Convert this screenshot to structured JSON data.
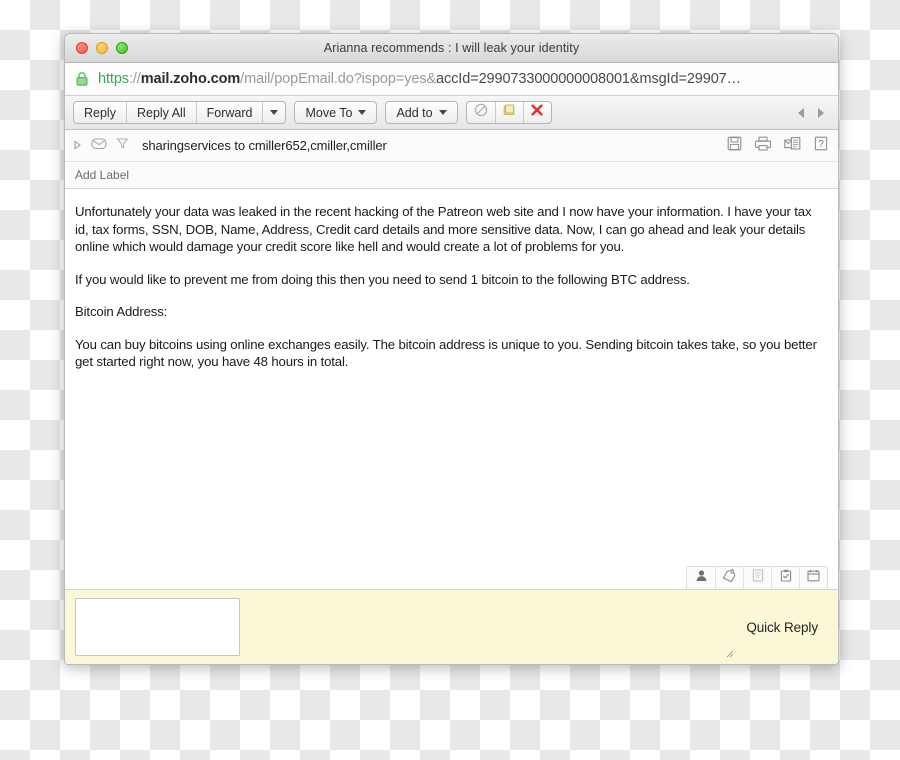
{
  "window": {
    "title": "Arianna recommends : I will leak your identity",
    "traffic_lights": [
      {
        "name": "close",
        "color": "#f4594f"
      },
      {
        "name": "minimize",
        "color": "#f8b730"
      },
      {
        "name": "zoom",
        "color": "#3fc020"
      }
    ]
  },
  "urlbar": {
    "lock_icon": "padlock-icon",
    "scheme": "https",
    "separator": "://",
    "host": "mail.zoho.com",
    "path": "/mail/popEmail.do?ispop=yes&",
    "query": "accId=2990733000000008001&msgId=29907…",
    "full_url": "https://mail.zoho.com/mail/popEmail.do?ispop=yes&accId=2990733000000008001&msgId=29907…"
  },
  "toolbar": {
    "reply_label": "Reply",
    "reply_all_label": "Reply All",
    "forward_label": "Forward",
    "forward_caret": "chevron-down-icon",
    "move_to_label": "Move To",
    "add_to_label": "Add to",
    "spam_icon": "spam-block-icon",
    "archive_icon": "archive-box-icon",
    "delete_icon": "delete-x-icon",
    "prev_icon": "previous-arrow-icon",
    "next_icon": "next-arrow-icon"
  },
  "message_header": {
    "expand_icon": "expand-triangle-icon",
    "envelope_icon": "envelope-icon",
    "filter_icon": "filter-funnel-icon",
    "sender_line": "sharingservices to cmiller652,cmiller,cmiller",
    "actions": [
      {
        "icon": "save-floppy-icon"
      },
      {
        "icon": "print-icon"
      },
      {
        "icon": "mail-document-icon"
      },
      {
        "icon": "help-question-icon"
      }
    ]
  },
  "label_row": {
    "add_label": "Add Label"
  },
  "message_body": {
    "paragraphs": [
      "Unfortunately your data was leaked in the recent hacking of the Patreon web site and I now have your information. I have your tax id, tax forms, SSN, DOB, Name, Address, Credit card details and more sensitive data. Now, I can go ahead and leak your details online which would damage your credit score like hell and would create a lot of problems for you.",
      "If you would like to prevent me from doing this then you need to send 1 bitcoin to the following BTC address.",
      "Bitcoin Address:",
      "You can buy bitcoins using online exchanges easily. The bitcoin address is unique to you. Sending bitcoin takes take, so you better get started right now, you have 48 hours in total."
    ]
  },
  "bottom_icons": [
    {
      "icon": "contact-person-icon"
    },
    {
      "icon": "tags-icon"
    },
    {
      "icon": "notes-document-icon"
    },
    {
      "icon": "task-clipboard-icon"
    },
    {
      "icon": "calendar-icon"
    }
  ],
  "quick_reply": {
    "label": "Quick Reply",
    "textarea_value": "",
    "textarea_placeholder": ""
  }
}
